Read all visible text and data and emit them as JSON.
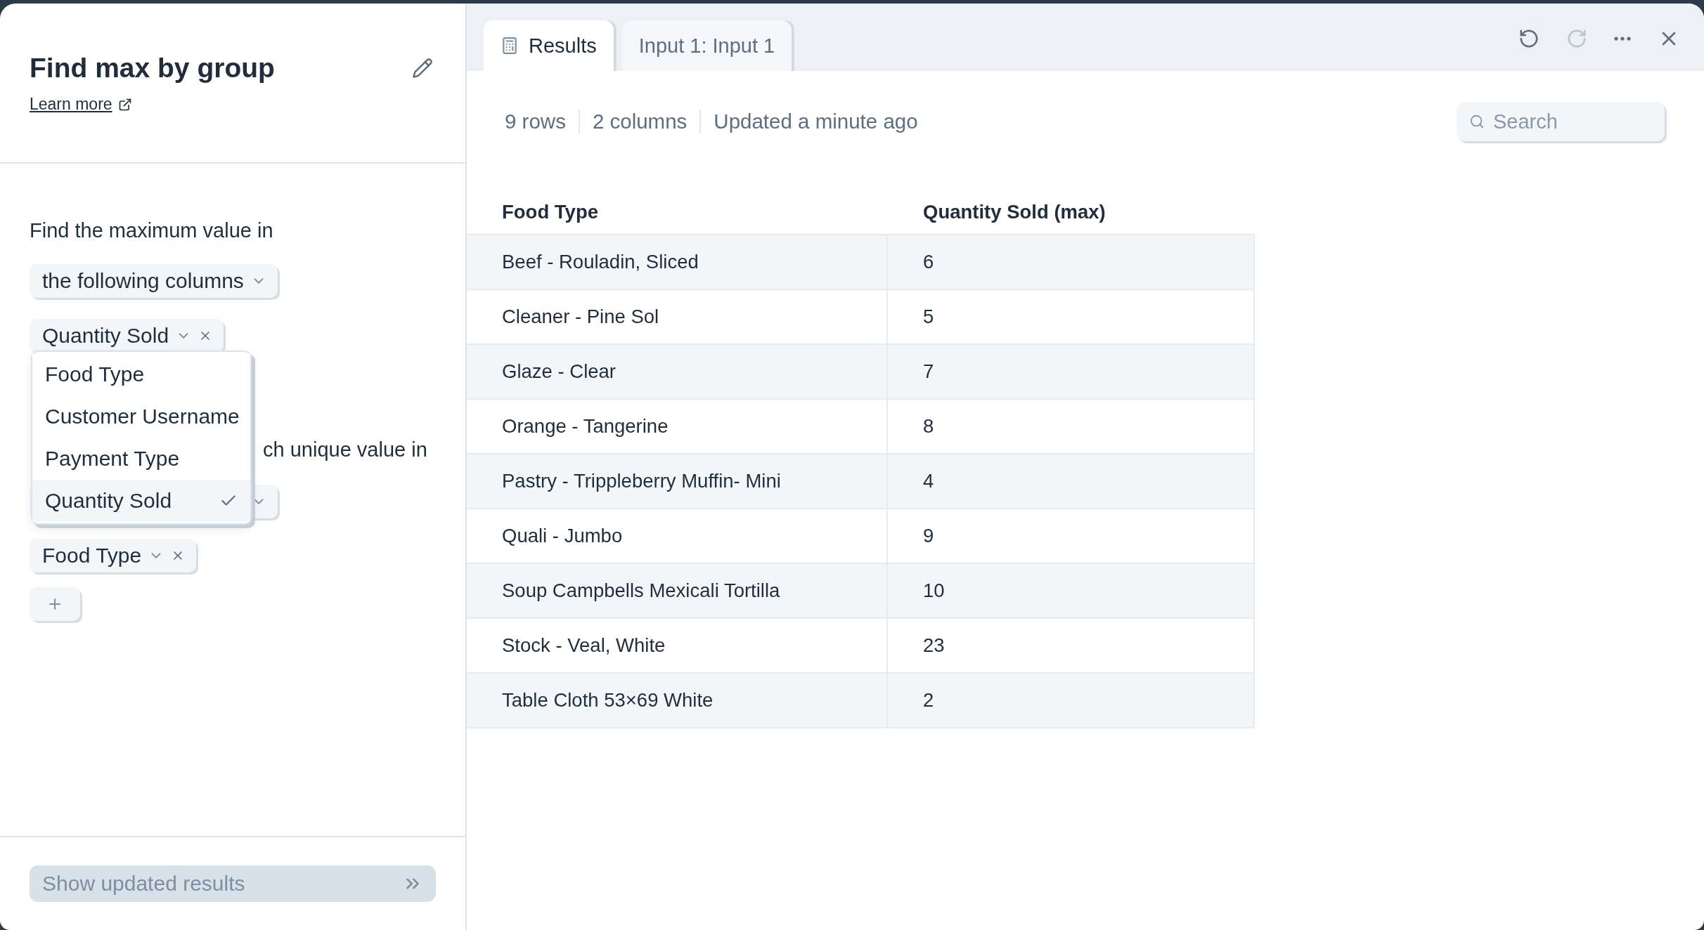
{
  "panel": {
    "title": "Find max by group",
    "learn_more": "Learn more",
    "prompt": "Find the maximum value in",
    "mode_select": "the following columns",
    "value_columns": [
      {
        "label": "Quantity Sold"
      }
    ],
    "menu": [
      {
        "label": "Food Type",
        "selected": false
      },
      {
        "label": "Customer Username",
        "selected": false
      },
      {
        "label": "Payment Type",
        "selected": false
      },
      {
        "label": "Quantity Sold",
        "selected": true
      }
    ],
    "group_prompt": "ch unique value in",
    "group_columns": [
      {
        "label": "Food Type"
      }
    ],
    "run_button": {
      "label": "Show updated results",
      "disabled": true
    }
  },
  "tabs": [
    {
      "label": "Results",
      "selected": true,
      "kind": "results"
    },
    {
      "label": "Input 1: Input 1",
      "selected": false,
      "kind": "input"
    }
  ],
  "toolbar": {
    "undo_disabled": false,
    "redo_disabled": true
  },
  "stats": [
    "9 rows",
    "2 columns",
    "Updated a minute ago"
  ],
  "search": {
    "placeholder": "Search"
  },
  "table": {
    "columns": [
      "Food Type",
      "Quantity Sold (max)"
    ],
    "rows": [
      [
        "Beef - Rouladin, Sliced",
        "6"
      ],
      [
        "Cleaner - Pine Sol",
        "5"
      ],
      [
        "Glaze - Clear",
        "7"
      ],
      [
        "Orange - Tangerine",
        "8"
      ],
      [
        "Pastry - Trippleberry Muffin- Mini",
        "4"
      ],
      [
        "Quali - Jumbo",
        "9"
      ],
      [
        "Soup Campbells Mexicali Tortilla",
        "10"
      ],
      [
        "Stock - Veal, White",
        "23"
      ],
      [
        "Table Cloth 53×69 White",
        "2"
      ]
    ]
  }
}
